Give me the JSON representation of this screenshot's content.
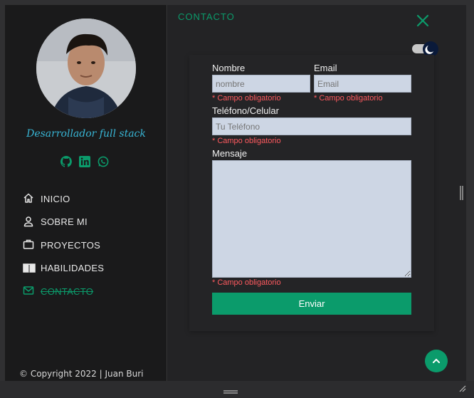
{
  "sidebar": {
    "role": "Desarrollador full stack",
    "socials": [
      {
        "icon": "github-icon"
      },
      {
        "icon": "linkedin-icon"
      },
      {
        "icon": "whatsapp-icon"
      }
    ],
    "nav": [
      {
        "label": "INICIO",
        "icon": "home-icon"
      },
      {
        "label": "SOBRE MI",
        "icon": "user-icon"
      },
      {
        "label": "PROYECTOS",
        "icon": "briefcase-icon"
      },
      {
        "label": "HABILIDADES",
        "icon": "book-icon"
      },
      {
        "label": "CONTACTO",
        "icon": "mail-icon",
        "active": true
      }
    ],
    "copyright": "© Copyright 2022 | Juan Buri"
  },
  "main": {
    "section_title": "CONTACTO",
    "form": {
      "name_label": "Nombre",
      "name_placeholder": "nombre",
      "email_label": "Email",
      "email_placeholder": "Email",
      "phone_label": "Teléfono/Celular",
      "phone_placeholder": "Tu Teléfono",
      "message_label": "Mensaje",
      "required_text": "* Campo obligatorio",
      "submit_label": "Enviar"
    }
  },
  "colors": {
    "accent": "#0b9b6b",
    "role_text": "#38b6d6",
    "error": "#ff5a5f",
    "field_bg": "#cdd6e4"
  }
}
